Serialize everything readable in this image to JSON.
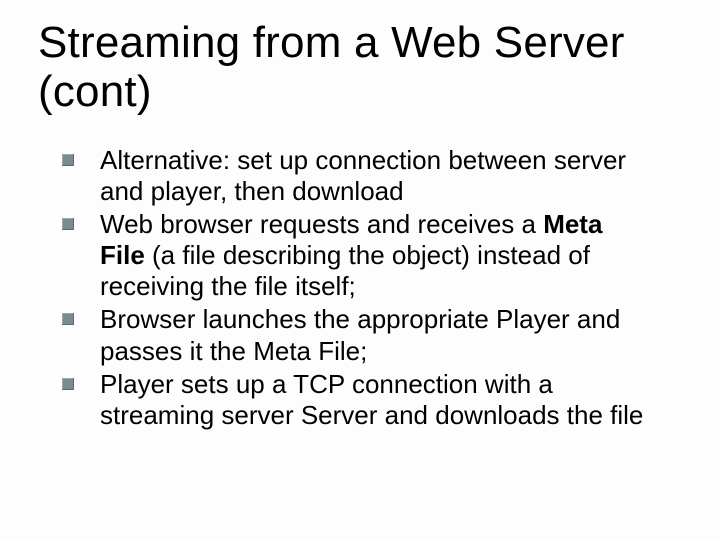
{
  "title": "Streaming from a Web Server (cont)",
  "bullets": [
    {
      "pre": "Alternative: set up connection between server and player, then download",
      "bold": "",
      "post": ""
    },
    {
      "pre": "Web browser requests and receives a ",
      "bold": "Meta File",
      "post": " (a file describing the object) instead of receiving the file itself;"
    },
    {
      "pre": "Browser launches the appropriate Player and passes it the Meta File;",
      "bold": "",
      "post": ""
    },
    {
      "pre": "Player sets up a TCP connection with a streaming server Server and downloads the file",
      "bold": "",
      "post": ""
    }
  ]
}
